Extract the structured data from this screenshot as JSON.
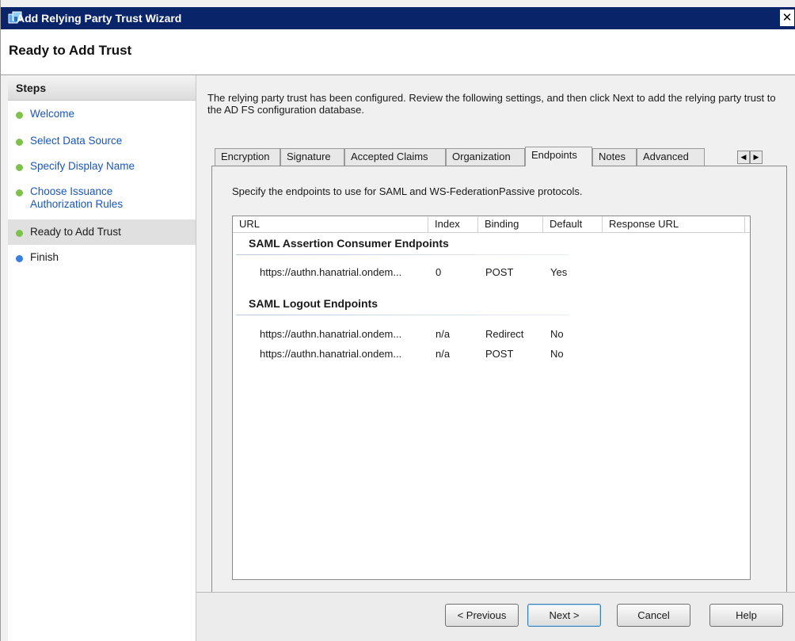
{
  "window": {
    "title": "Add Relying Party Trust Wizard",
    "close_glyph": "✕"
  },
  "header": {
    "page_title": "Ready to Add Trust"
  },
  "steps": {
    "heading": "Steps",
    "items": [
      {
        "label": "Welcome",
        "state": "done"
      },
      {
        "label": "Select Data Source",
        "state": "done"
      },
      {
        "label": "Specify Display Name",
        "state": "done"
      },
      {
        "label": "Choose Issuance Authorization Rules",
        "state": "done"
      },
      {
        "label": "Ready to Add Trust",
        "state": "current"
      },
      {
        "label": "Finish",
        "state": "pending"
      }
    ]
  },
  "main": {
    "intro": "The relying party trust has been configured. Review the following settings, and then click Next to add the relying party trust to the AD FS configuration database.",
    "tabs": [
      {
        "label": "Encryption"
      },
      {
        "label": "Signature"
      },
      {
        "label": "Accepted Claims"
      },
      {
        "label": "Organization"
      },
      {
        "label": "Endpoints",
        "active": true
      },
      {
        "label": "Notes"
      },
      {
        "label": "Advanced"
      }
    ],
    "tab_scroll": {
      "left": "◀",
      "right": "▶"
    },
    "endpoints": {
      "description": "Specify the endpoints to use for SAML and WS-FederationPassive protocols.",
      "columns": [
        "URL",
        "Index",
        "Binding",
        "Default",
        "Response URL"
      ],
      "groups": [
        {
          "title": "SAML Assertion Consumer Endpoints",
          "rows": [
            {
              "url": "https://authn.hanatrial.ondem...",
              "index": "0",
              "binding": "POST",
              "default": "Yes",
              "response_url": ""
            }
          ]
        },
        {
          "title": "SAML Logout Endpoints",
          "rows": [
            {
              "url": "https://authn.hanatrial.ondem...",
              "index": "n/a",
              "binding": "Redirect",
              "default": "No",
              "response_url": ""
            },
            {
              "url": "https://authn.hanatrial.ondem...",
              "index": "n/a",
              "binding": "POST",
              "default": "No",
              "response_url": ""
            }
          ]
        }
      ]
    }
  },
  "footer": {
    "previous_label": "< Previous",
    "next_label": "Next >",
    "cancel_label": "Cancel",
    "help_label": "Help"
  },
  "colors": {
    "title_bar": "#0a246a",
    "step_done": "#7ec24a",
    "step_pending": "#3a7fe0",
    "step_link": "#1a56b8"
  }
}
